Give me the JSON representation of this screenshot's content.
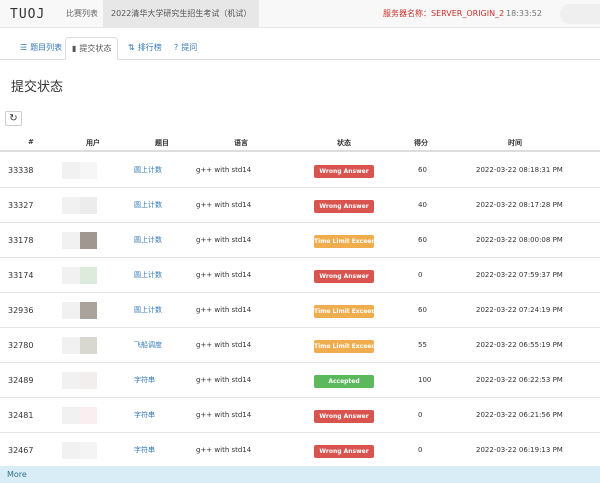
{
  "header": {
    "logo": "TUOJ",
    "nav_contests": "比赛列表",
    "nav_current": "2022清华大学研究生招生考试（机试）",
    "server": "服务器名称：SERVER_ORIGIN_2",
    "clock": "18:33:52"
  },
  "tabs": [
    {
      "label": "题目列表",
      "icon": "list-icon",
      "glyph": "☰"
    },
    {
      "label": "提交状态",
      "icon": "bar-chart-icon",
      "glyph": "▮"
    },
    {
      "label": "排行榜",
      "icon": "sort-icon",
      "glyph": "⇅"
    },
    {
      "label": "提问",
      "icon": "question-circle-icon",
      "glyph": "?"
    }
  ],
  "page_title": "提交状态",
  "refresh_icon": "refresh-icon",
  "table": {
    "headers": [
      "#",
      "用户",
      "题目",
      "语言",
      "状态",
      "得分",
      "时间"
    ],
    "rows": [
      {
        "id": "33338",
        "problem": "圆上计数",
        "lang": "g++ with std14",
        "status": "Wrong Answer",
        "status_color": "#d9534f",
        "score": "60",
        "time": "2022-03-22 08:18:31 PM",
        "swatch": "#f6f6f6"
      },
      {
        "id": "33327",
        "problem": "圆上计数",
        "lang": "g++ with std14",
        "status": "Wrong Answer",
        "status_color": "#d9534f",
        "score": "40",
        "time": "2022-03-22 08:17:28 PM",
        "swatch": "#ececec"
      },
      {
        "id": "33178",
        "problem": "圆上计数",
        "lang": "g++ with std14",
        "status": "Time Limit Exceeded",
        "status_color": "#f0ad4e",
        "score": "60",
        "time": "2022-03-22 08:00:08 PM",
        "swatch": "#a09890"
      },
      {
        "id": "33174",
        "problem": "圆上计数",
        "lang": "g++ with std14",
        "status": "Wrong Answer",
        "status_color": "#d9534f",
        "score": "0",
        "time": "2022-03-22 07:59:37 PM",
        "swatch": "#dcebdc"
      },
      {
        "id": "32936",
        "problem": "圆上计数",
        "lang": "g++ with std14",
        "status": "Time Limit Exceeded",
        "status_color": "#f0ad4e",
        "score": "60",
        "time": "2022-03-22 07:24:19 PM",
        "swatch": "#aaa39c"
      },
      {
        "id": "32780",
        "problem": "飞船调度",
        "lang": "g++ with std14",
        "status": "Time Limit Exceeded",
        "status_color": "#f0ad4e",
        "score": "55",
        "time": "2022-03-22 06:55:19 PM",
        "swatch": "#d8d8d0"
      },
      {
        "id": "32489",
        "problem": "字符串",
        "lang": "g++ with std14",
        "status": "Accepted",
        "status_color": "#5cb85c",
        "score": "100",
        "time": "2022-03-22 06:22:53 PM",
        "swatch": "#f2eeee"
      },
      {
        "id": "32481",
        "problem": "字符串",
        "lang": "g++ with std14",
        "status": "Wrong Answer",
        "status_color": "#d9534f",
        "score": "0",
        "time": "2022-03-22 06:21:56 PM",
        "swatch": "#fbeef0"
      },
      {
        "id": "32467",
        "problem": "字符串",
        "lang": "g++ with std14",
        "status": "Wrong Answer",
        "status_color": "#d9534f",
        "score": "0",
        "time": "2022-03-22 06:19:13 PM",
        "swatch": "#f4f4f4"
      }
    ]
  },
  "more": "More"
}
